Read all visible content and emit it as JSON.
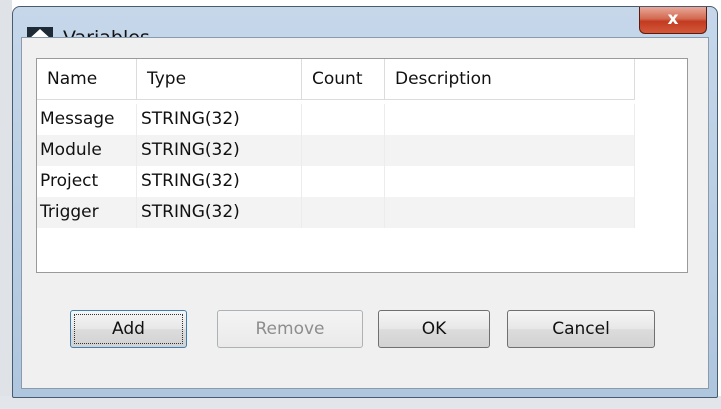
{
  "dialog": {
    "title": "Variables",
    "close_label": "x"
  },
  "table": {
    "columns": [
      "Name",
      "Type",
      "Count",
      "Description"
    ],
    "rows": [
      {
        "name": "Message",
        "type": "STRING(32)",
        "count": "",
        "description": ""
      },
      {
        "name": "Module",
        "type": "STRING(32)",
        "count": "",
        "description": ""
      },
      {
        "name": "Project",
        "type": "STRING(32)",
        "count": "",
        "description": ""
      },
      {
        "name": "Trigger",
        "type": "STRING(32)",
        "count": "",
        "description": ""
      }
    ]
  },
  "buttons": {
    "add": "Add",
    "remove": "Remove",
    "ok": "OK",
    "cancel": "Cancel"
  },
  "icons": {
    "app": "arrows-up-down-icon",
    "close": "close-icon"
  },
  "colors": {
    "close_red": "#c23b22",
    "icon_gold": "#f2b51c",
    "icon_dark": "#1f2a37"
  }
}
